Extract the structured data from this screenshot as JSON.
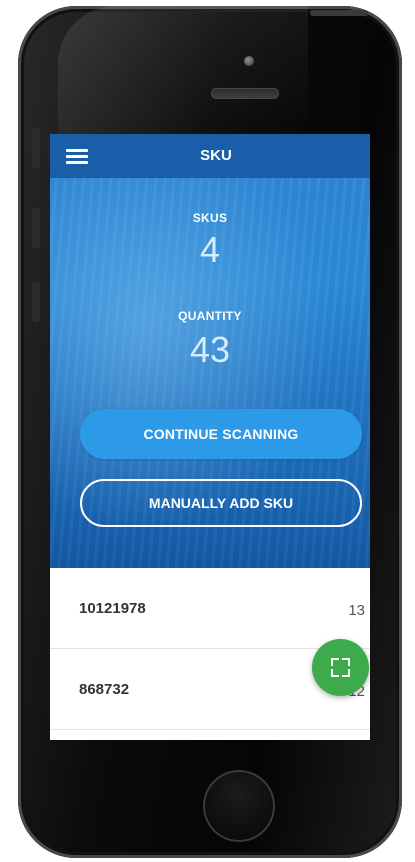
{
  "appbar": {
    "title": "SKU"
  },
  "stats": {
    "skus_label": "SKUS",
    "skus_value": "4",
    "quantity_label": "QUANTITY",
    "quantity_value": "43"
  },
  "actions": {
    "continue_label": "CONTINUE SCANNING",
    "manual_label": "MANUALLY ADD SKU"
  },
  "list": [
    {
      "code": "10121978",
      "qty": "13"
    },
    {
      "code": "868732",
      "qty": "12"
    }
  ],
  "icons": {
    "menu": "hamburger-menu-icon",
    "fab": "scan-frame-icon"
  },
  "colors": {
    "appbar": "#1a5ea9",
    "primary_button": "#2d9ae8",
    "fab": "#3dab4b"
  }
}
